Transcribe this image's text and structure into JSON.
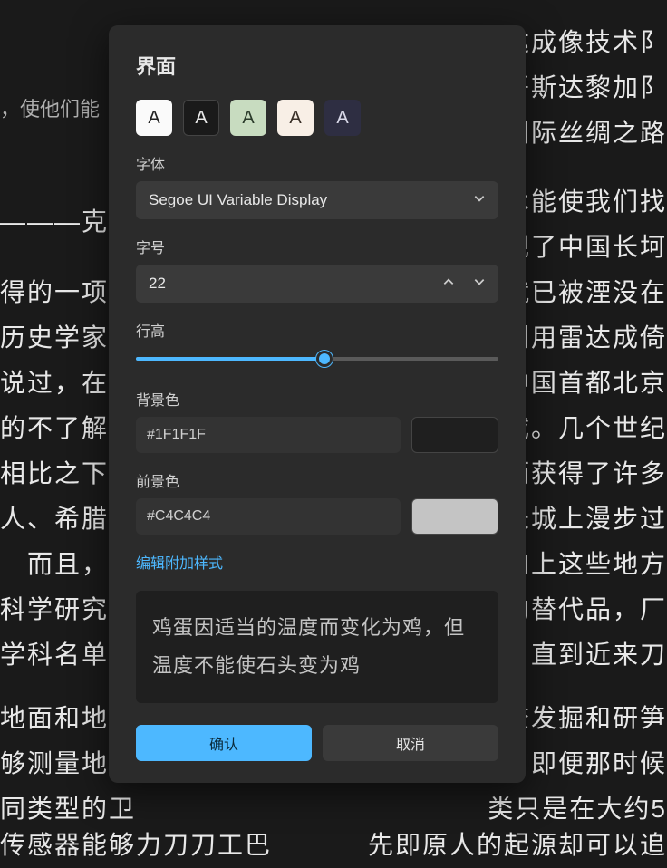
{
  "dialog": {
    "title": "界面",
    "themes": [
      {
        "name": "light",
        "glyph": "A"
      },
      {
        "name": "dark",
        "glyph": "A"
      },
      {
        "name": "green",
        "glyph": "A"
      },
      {
        "name": "cream",
        "glyph": "A"
      },
      {
        "name": "navy",
        "glyph": "A"
      }
    ],
    "font_label": "字体",
    "font_value": "Segoe UI Variable Display",
    "fontsize_label": "字号",
    "fontsize_value": "22",
    "lineheight_label": "行高",
    "lineheight_percent": 52,
    "bgcolor_label": "背景色",
    "bgcolor_value": "#1F1F1F",
    "bgcolor_hex": "#1F1F1F",
    "fgcolor_label": "前景色",
    "fgcolor_value": "#C4C4C4",
    "fgcolor_hex": "#C4C4C4",
    "edit_styles_link": "编辑附加样式",
    "preview_text": "鸡蛋因适当的温度而变化为鸡，但温度不能使石头变为鸡",
    "confirm": "确认",
    "cancel": "取消"
  },
  "bg": {
    "l1": "，使他们能",
    "l2": "———克莱徐",
    "l3": "得的一项杰",
    "l4": "历史学家申",
    "l5": "说过，在任",
    "l6": "的不了解，",
    "l7": "相比之下，",
    "l8": "人、希腊人",
    "l9": "　而且，地",
    "l10": "科学研究成",
    "l11": "学科名单上",
    "l12": "地面和地下",
    "l13": "够测量地面",
    "l14": "同类型的卫",
    "l15": "传感器能够力刀刀工巴",
    "r0a": "雷达成像技术阝",
    "r0b": "和哥斯达黎加阝",
    "r0c": "代洲际丝绸之路",
    "r1": "术能使我们找",
    "r2": "发现了中国长坷",
    "r3": "就已被湮没在",
    "r4": "机利用雷达成倚",
    "r5": "中国首都北京",
    "r6": "成。几个世纪",
    "r7": "从而获得了许多",
    "r8": "长城上漫步过",
    "r9": "再加上这些地方",
    "r10": "见的替代品，厂",
    "r11": "灭，直到近来刀",
    "r12": "调查发掘和研笋",
    "r13": "　即便那时候",
    "r14": "类只是在大约5",
    "r15": "先即原人的起源却可以追"
  }
}
